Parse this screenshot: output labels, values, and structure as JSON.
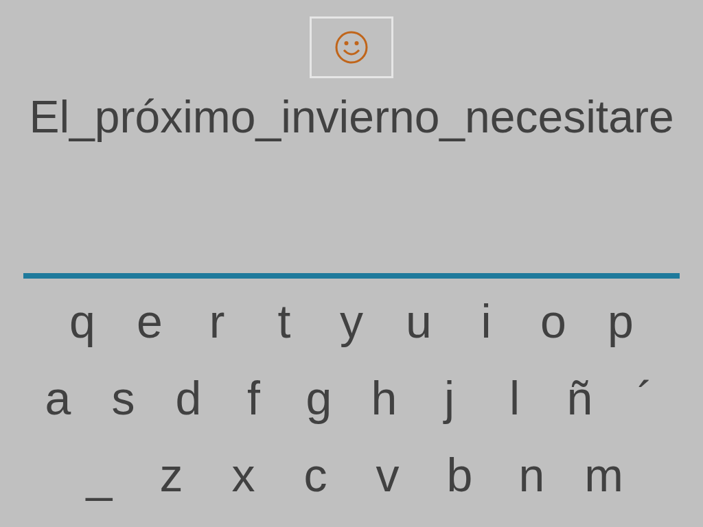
{
  "prompt": "El_próximo_invierno_necesitare",
  "keyboard": {
    "rows": [
      [
        "q",
        "e",
        "r",
        "t",
        "y",
        "u",
        "i",
        "o",
        "p"
      ],
      [
        "a",
        "s",
        "d",
        "f",
        "g",
        "h",
        "j",
        "l",
        "ñ",
        "´"
      ],
      [
        "_",
        "z",
        "x",
        "c",
        "v",
        "b",
        "n",
        "m"
      ]
    ]
  }
}
